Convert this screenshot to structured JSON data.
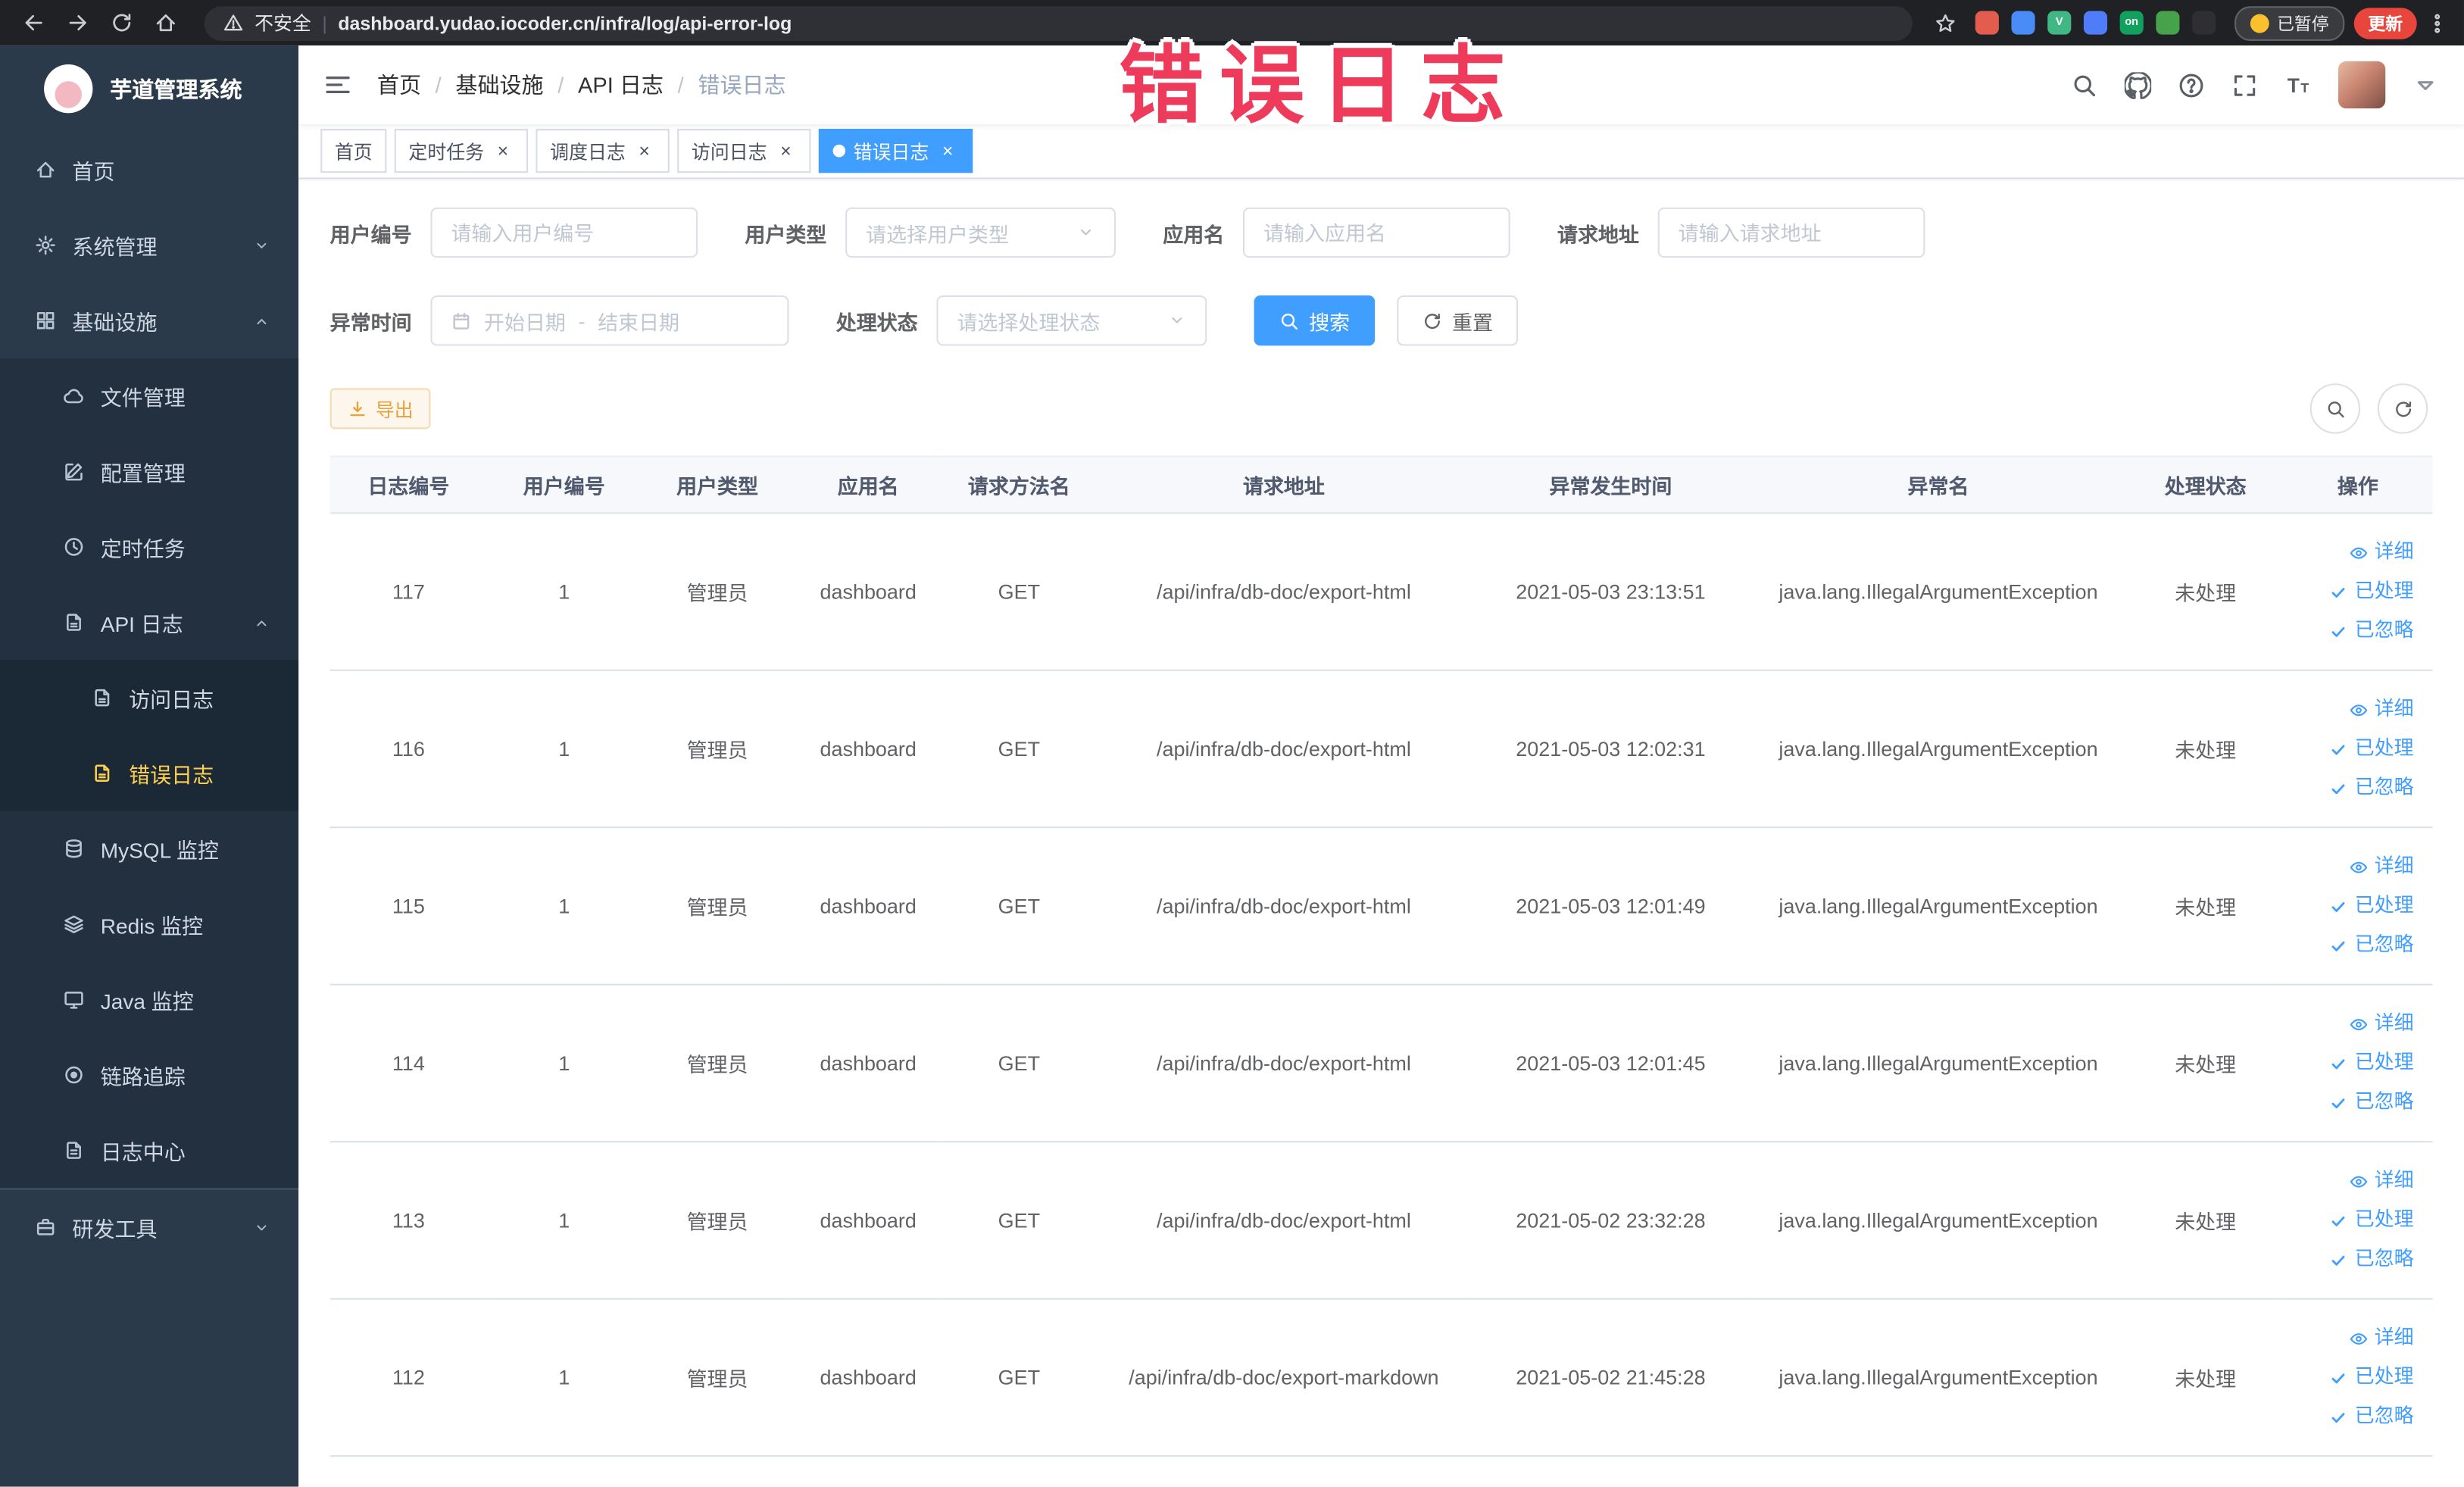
{
  "colors": {
    "accent": "#409eff",
    "menu_active": "#ffd04b",
    "update": "#e8453c",
    "warning": "#e6a23c",
    "annotation": "#ee3b5c"
  },
  "annotation": {
    "text": "错误日志"
  },
  "browser": {
    "security_label": "不安全",
    "url": "dashboard.yudao.iocoder.cn/infra/log/api-error-log",
    "paused_label": "已暂停",
    "update_label": "更新",
    "nav_icons": [
      "back",
      "forward",
      "reload",
      "home"
    ],
    "extensions": [
      {
        "color": "#e35d4f",
        "text": ""
      },
      {
        "color": "#4a8cf7",
        "text": ""
      },
      {
        "color": "#41b883",
        "text": "V"
      },
      {
        "color": "#4f7df9",
        "text": ""
      },
      {
        "color": "#12a05f",
        "text": "on"
      },
      {
        "color": "#46a34b",
        "text": ""
      },
      {
        "color": "#2f2f33",
        "text": ""
      }
    ]
  },
  "sidebar": {
    "logo_title": "芋道管理系统",
    "menu": [
      {
        "label": "首页",
        "icon": "home",
        "level": 0
      },
      {
        "label": "系统管理",
        "icon": "gear",
        "level": 0,
        "arrow": "down"
      },
      {
        "label": "基础设施",
        "icon": "grid",
        "level": 0,
        "arrow": "up"
      },
      {
        "label": "文件管理",
        "icon": "cloud",
        "level": 1
      },
      {
        "label": "配置管理",
        "icon": "edit",
        "level": 1
      },
      {
        "label": "定时任务",
        "icon": "clock",
        "level": 1
      },
      {
        "label": "API 日志",
        "icon": "doc-edit",
        "level": 1,
        "arrow": "up"
      },
      {
        "label": "访问日志",
        "icon": "doc-edit",
        "level": 2
      },
      {
        "label": "错误日志",
        "icon": "doc-edit",
        "level": 2,
        "active": true
      },
      {
        "label": "MySQL 监控",
        "icon": "database",
        "level": 1
      },
      {
        "label": "Redis 监控",
        "icon": "layers",
        "level": 1
      },
      {
        "label": "Java 监控",
        "icon": "monitor",
        "level": 1
      },
      {
        "label": "链路追踪",
        "icon": "eye-circle",
        "level": 1
      },
      {
        "label": "日志中心",
        "icon": "doc",
        "level": 1
      },
      {
        "label": "研发工具",
        "icon": "briefcase",
        "level": 0,
        "arrow": "down",
        "section": true
      }
    ]
  },
  "navbar": {
    "breadcrumb": [
      {
        "label": "首页"
      },
      {
        "label": "基础设施"
      },
      {
        "label": "API 日志"
      },
      {
        "label": "错误日志",
        "current": true
      }
    ],
    "icons": [
      "search",
      "github",
      "question",
      "fullscreen",
      "font-size"
    ]
  },
  "tabs": [
    {
      "label": "首页",
      "closable": false,
      "active": false
    },
    {
      "label": "定时任务",
      "closable": true,
      "active": false
    },
    {
      "label": "调度日志",
      "closable": true,
      "active": false
    },
    {
      "label": "访问日志",
      "closable": true,
      "active": false
    },
    {
      "label": "错误日志",
      "closable": true,
      "active": true
    }
  ],
  "filters": {
    "user_id": {
      "label": "用户编号",
      "placeholder": "请输入用户编号"
    },
    "user_type": {
      "label": "用户类型",
      "placeholder": "请选择用户类型"
    },
    "app_name": {
      "label": "应用名",
      "placeholder": "请输入应用名"
    },
    "request_url": {
      "label": "请求地址",
      "placeholder": "请输入请求地址"
    },
    "exception_time": {
      "label": "异常时间",
      "start_placeholder": "开始日期",
      "separator": "-",
      "end_placeholder": "结束日期"
    },
    "process_status": {
      "label": "处理状态",
      "placeholder": "请选择处理状态"
    },
    "search_label": "搜索",
    "reset_label": "重置"
  },
  "toolbar": {
    "export_label": "导出"
  },
  "table": {
    "columns": [
      "日志编号",
      "用户编号",
      "用户类型",
      "应用名",
      "请求方法名",
      "请求地址",
      "异常发生时间",
      "异常名",
      "处理状态",
      "操作"
    ],
    "actions": [
      {
        "label": "详细",
        "icon": "eye"
      },
      {
        "label": "已处理",
        "icon": "check"
      },
      {
        "label": "已忽略",
        "icon": "check"
      }
    ],
    "rows": [
      {
        "id": "117",
        "user_id": "1",
        "user_type": "管理员",
        "app": "dashboard",
        "method": "GET",
        "url": "/api/infra/db-doc/export-html",
        "time": "2021-05-03 23:13:51",
        "exception": "java.lang.IllegalArgumentException",
        "status": "未处理"
      },
      {
        "id": "116",
        "user_id": "1",
        "user_type": "管理员",
        "app": "dashboard",
        "method": "GET",
        "url": "/api/infra/db-doc/export-html",
        "time": "2021-05-03 12:02:31",
        "exception": "java.lang.IllegalArgumentException",
        "status": "未处理"
      },
      {
        "id": "115",
        "user_id": "1",
        "user_type": "管理员",
        "app": "dashboard",
        "method": "GET",
        "url": "/api/infra/db-doc/export-html",
        "time": "2021-05-03 12:01:49",
        "exception": "java.lang.IllegalArgumentException",
        "status": "未处理"
      },
      {
        "id": "114",
        "user_id": "1",
        "user_type": "管理员",
        "app": "dashboard",
        "method": "GET",
        "url": "/api/infra/db-doc/export-html",
        "time": "2021-05-03 12:01:45",
        "exception": "java.lang.IllegalArgumentException",
        "status": "未处理"
      },
      {
        "id": "113",
        "user_id": "1",
        "user_type": "管理员",
        "app": "dashboard",
        "method": "GET",
        "url": "/api/infra/db-doc/export-html",
        "time": "2021-05-02 23:32:28",
        "exception": "java.lang.IllegalArgumentException",
        "status": "未处理"
      },
      {
        "id": "112",
        "user_id": "1",
        "user_type": "管理员",
        "app": "dashboard",
        "method": "GET",
        "url": "/api/infra/db-doc/export-markdown",
        "time": "2021-05-02 21:45:28",
        "exception": "java.lang.IllegalArgumentException",
        "status": "未处理"
      }
    ]
  }
}
